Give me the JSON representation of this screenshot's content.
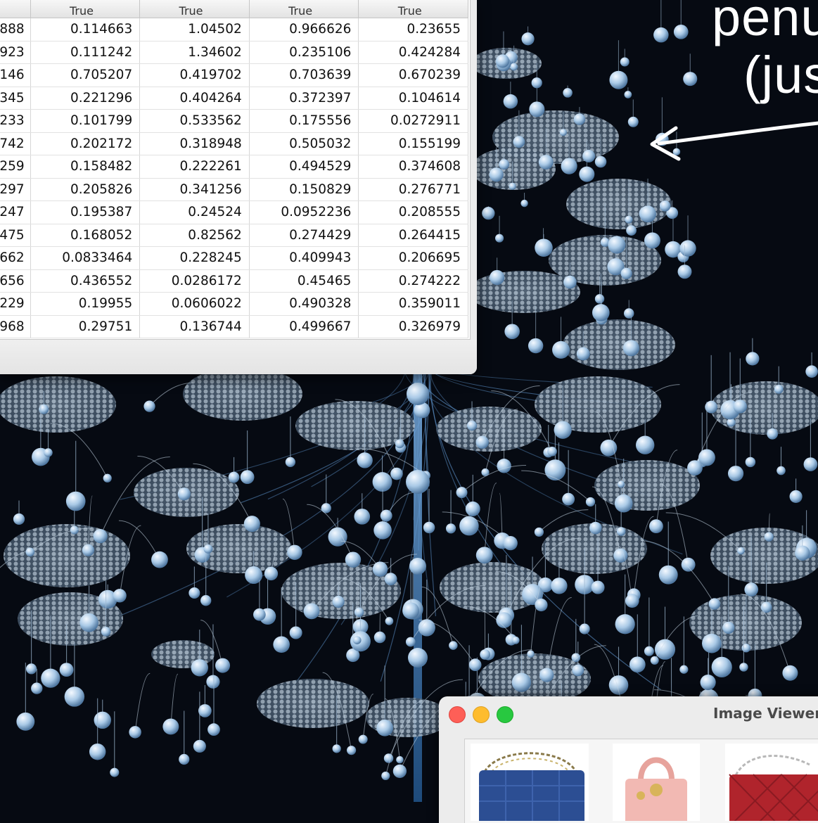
{
  "colors": {
    "background": "#060a12",
    "node_light": "#cfe3f5",
    "node_blue": "#8fb8dc",
    "trunk_glow": "#4a90d9",
    "caption_text": "#ffffff",
    "close": "#fe5f57",
    "minimize": "#febc2e",
    "maximize": "#28c840",
    "bag_blue": "#2c4e93",
    "bag_pink": "#f2b9b3",
    "bag_red": "#b0242c"
  },
  "table": {
    "headers": [
      "",
      "True",
      "True",
      "True",
      "True"
    ],
    "rows": [
      [
        "888",
        "0.114663",
        "1.04502",
        "0.966626",
        "0.23655"
      ],
      [
        "923",
        "0.111242",
        "1.34602",
        "0.235106",
        "0.424284"
      ],
      [
        "146",
        "0.705207",
        "0.419702",
        "0.703639",
        "0.670239"
      ],
      [
        "345",
        "0.221296",
        "0.404264",
        "0.372397",
        "0.104614"
      ],
      [
        "233",
        "0.101799",
        "0.533562",
        "0.175556",
        "0.0272911"
      ],
      [
        "742",
        "0.202172",
        "0.318948",
        "0.505032",
        "0.155199"
      ],
      [
        "259",
        "0.158482",
        "0.222261",
        "0.494529",
        "0.374608"
      ],
      [
        "297",
        "0.205826",
        "0.341256",
        "0.150829",
        "0.276771"
      ],
      [
        "247",
        "0.195387",
        "0.24524",
        "0.0952236",
        "0.208555"
      ],
      [
        "475",
        "0.168052",
        "0.82562",
        "0.274429",
        "0.264415"
      ],
      [
        "662",
        "0.0833464",
        "0.228245",
        "0.409943",
        "0.206695"
      ],
      [
        "656",
        "0.436552",
        "0.0286172",
        "0.45465",
        "0.274222"
      ],
      [
        "229",
        "0.19955",
        "0.0606022",
        "0.490328",
        "0.359011"
      ],
      [
        "968",
        "0.29751",
        "0.136744",
        "0.499667",
        "0.326979"
      ]
    ]
  },
  "caption": {
    "line1": "penu",
    "line2": "(jus"
  },
  "viewer": {
    "title": "Image Viewer",
    "thumbnails": [
      {
        "icon": "blue-quilted-handbag-icon"
      },
      {
        "icon": "pink-handbag-icon"
      },
      {
        "icon": "red-quilted-handbag-icon"
      }
    ]
  }
}
